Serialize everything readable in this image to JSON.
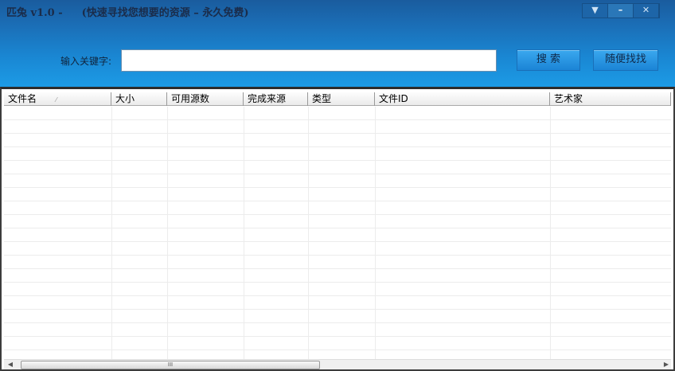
{
  "window": {
    "app_name": "匹兔 v1.0 -",
    "subtitle": "(快速寻找您想要的资源 – 永久免费)",
    "menu_icon": "▼",
    "minimize_icon": "–",
    "close_icon": "✕"
  },
  "search": {
    "label": "输入关键字:",
    "value": "",
    "search_button": "搜 索",
    "random_button": "随便找找"
  },
  "table": {
    "columns": [
      "文件名",
      "大小",
      "可用源数",
      "完成来源",
      "类型",
      "文件ID",
      "艺术家"
    ],
    "sort_indicator": "⁄",
    "rows": []
  },
  "scrollbar": {
    "left_arrow": "◀",
    "right_arrow": "▶",
    "grip": "III"
  }
}
